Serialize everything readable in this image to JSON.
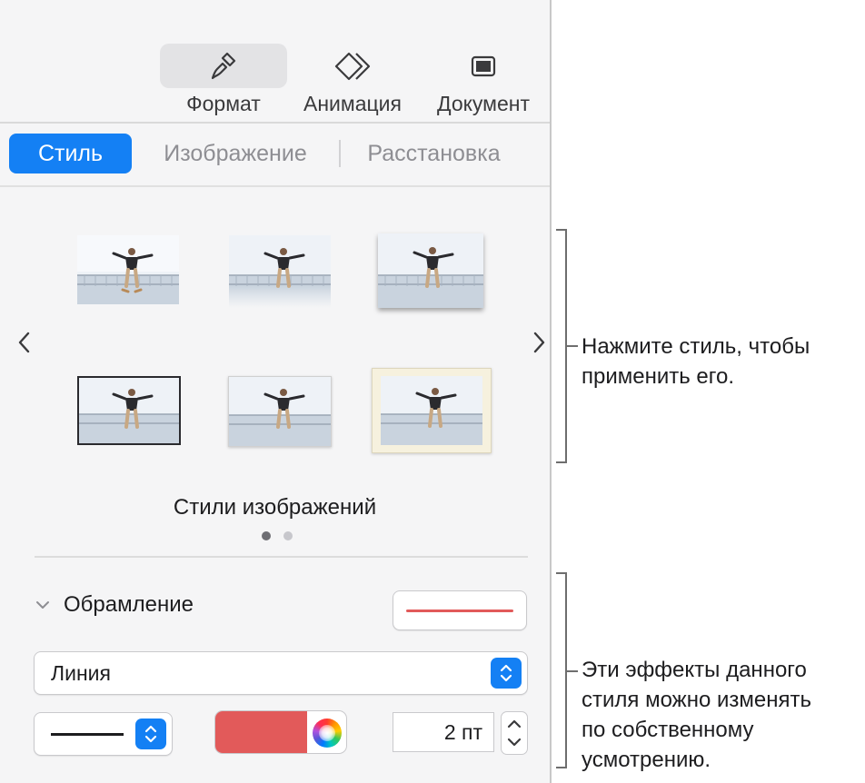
{
  "toolbar": {
    "format_label": "Формат",
    "animation_label": "Анимация",
    "document_label": "Документ"
  },
  "tabs": {
    "style": "Стиль",
    "image": "Изображение",
    "arrange": "Расстановка"
  },
  "style_gallery": {
    "title": "Стили изображений",
    "page_count": 2,
    "current_page": 1
  },
  "border": {
    "label": "Обрамление",
    "type_value": "Линия",
    "color": "#e25a5a",
    "width_value": "2 пт"
  },
  "callouts": {
    "styles_line1": "Нажмите стиль, чтобы",
    "styles_line2": "применить его.",
    "effects_line1": "Эти эффекты данного",
    "effects_line2": "стиля можно изменять",
    "effects_line3": "по собственному",
    "effects_line4": "усмотрению."
  },
  "colors": {
    "accent": "#1480f4",
    "border_color": "#e25a5a"
  }
}
